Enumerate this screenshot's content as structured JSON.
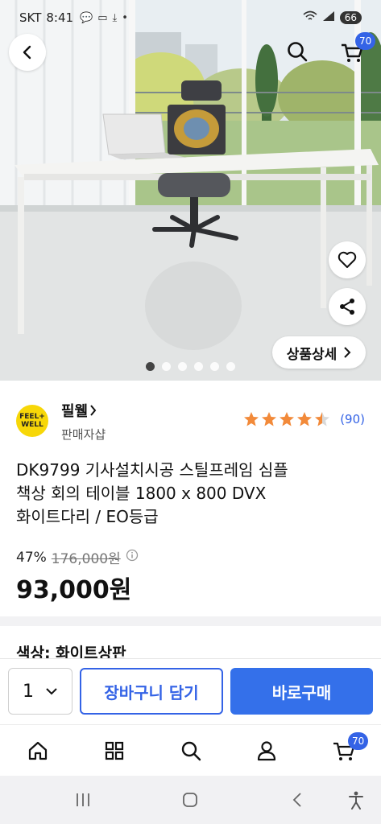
{
  "status_bar": {
    "carrier": "SKT",
    "time": "8:41",
    "battery": "66"
  },
  "header": {
    "cart_count": "70"
  },
  "hero": {
    "detail_button_label": "상품상세",
    "image_count": 6,
    "active_image_index": 0
  },
  "seller": {
    "name": "필웰",
    "subtitle": "판매자샵",
    "logo_text_line1": "FEEL+",
    "logo_text_line2": "WELL",
    "rating": 4.5,
    "review_count": "(90)"
  },
  "product": {
    "title_line1": "DK9799 기사설치시공 스틸프레임 심플",
    "title_line2": "책상 회의 테이블 1800 x 800 DVX",
    "title_line3": "화이트다리 / EO등급",
    "discount_percent": "47%",
    "original_price": "176,000원",
    "sale_price": "93,000원"
  },
  "option_peek": "색상: 화이트상판",
  "purchase_bar": {
    "quantity": "1",
    "cart_button": "장바구니 담기",
    "buy_button": "바로구매"
  },
  "bottom_nav": {
    "cart_count": "70"
  },
  "colors": {
    "accent": "#3463e6",
    "buy": "#3470ea",
    "star": "#f28a3a",
    "logo": "#f7d708"
  }
}
